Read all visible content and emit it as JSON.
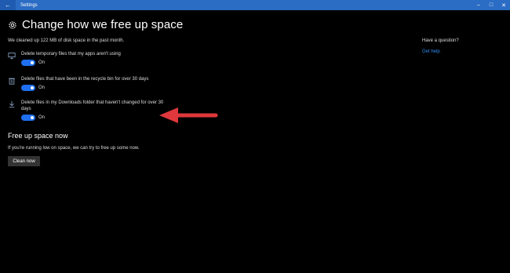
{
  "window": {
    "title": "Settings",
    "back_glyph": "←",
    "controls": {
      "minimize": "–",
      "maximize": "□",
      "close": "✕"
    }
  },
  "header": {
    "title": "Change how we free up space",
    "icon": "gear-icon"
  },
  "summary": "We cleaned up 122 MB of disk space in the past month.",
  "options": [
    {
      "icon": "monitor-icon",
      "label": "Delete temporary files that my apps aren't using",
      "state": "On"
    },
    {
      "icon": "recycle-bin-icon",
      "label": "Delete files that have been in the recycle bin for over 30 days",
      "state": "On"
    },
    {
      "icon": "download-icon",
      "label": "Delete files in my Downloads folder that haven't changed for over 30 days",
      "state": "On"
    }
  ],
  "free_up": {
    "title": "Free up space now",
    "description": "If you're running low on space, we can try to free up some now.",
    "button": "Clean now"
  },
  "aside": {
    "title": "Have a question?",
    "link": "Get help"
  },
  "colors": {
    "titlebar": "#2b6cc4",
    "toggle": "#1f6ff0",
    "link": "#2f8cf2",
    "annotation_arrow": "#e0383c"
  }
}
